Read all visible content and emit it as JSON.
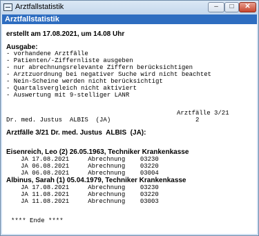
{
  "window": {
    "title": "Arztfallstatistik",
    "minimize": "–",
    "maximize": "□",
    "close": "✕"
  },
  "header": {
    "label": "Arztfallstatistik"
  },
  "report": {
    "created": "erstellt am 17.08.2021, um 14.08 Uhr",
    "output_title": "Ausgabe:",
    "options": [
      "- vorhandene Arztfälle",
      "- Patienten/-Ziffernliste ausgeben",
      "- nur abrechnungsrelevante Ziffern berücksichtigen",
      "- Arztzuordnung bei negativer Suche wird nicht beachtet",
      "- Nein-Scheine werden nicht berücksichtigt",
      "- Quartalsvergleich nicht aktiviert",
      "- Auswertung mit 9-stelliger LANR"
    ],
    "summary_header": "Arztfälle 3/21",
    "summary_doctor": "Dr. med. Justus  ALBIS  (JA)",
    "summary_count": "2",
    "section_title": "Arztfälle 3/21 Dr. med. Justus  ALBIS  (JA):",
    "patients": [
      {
        "heading": "Eisenreich, Leo (2) 26.05.1963, Techniker Krankenkasse",
        "rows": [
          "JA 17.08.2021     Abrechnung    03230",
          "JA 06.08.2021     Abrechnung    03220",
          "JA 06.08.2021     Abrechnung    03004"
        ]
      },
      {
        "heading": "Albinus, Sarah (1) 05.04.1979, Techniker Krankenkasse",
        "rows": [
          "JA 17.08.2021     Abrechnung    03230",
          "JA 11.08.2021     Abrechnung    03220",
          "JA 11.08.2021     Abrechnung    03003"
        ]
      }
    ],
    "end": "**** Ende ****"
  }
}
